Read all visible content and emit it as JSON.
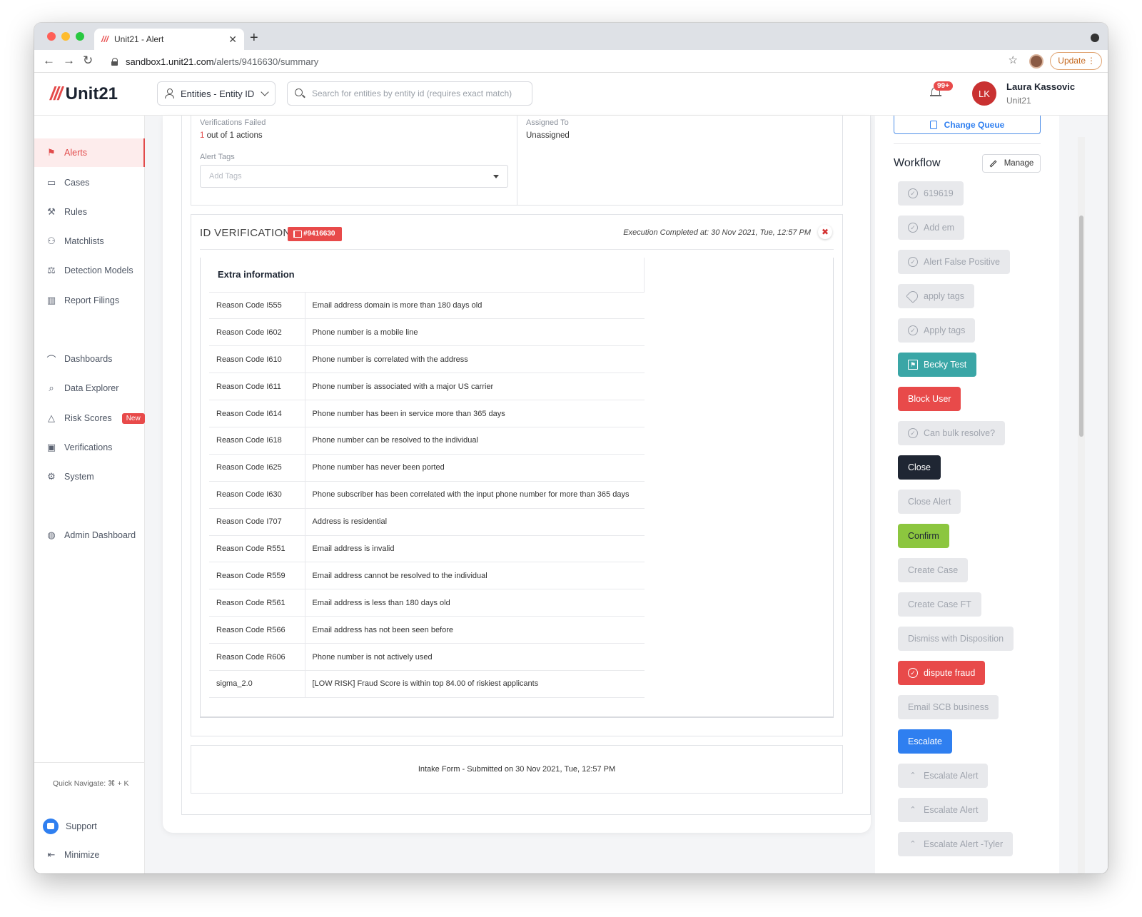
{
  "browser": {
    "tab_title": "Unit21 - Alert",
    "tab_favicon": "///",
    "tab_close": "✕",
    "new_tab": "+",
    "url_host": "sandbox1.unit21.com",
    "url_path": "/alerts/9416630/summary",
    "update_label": "Update"
  },
  "header": {
    "logo_mark": "///",
    "logo_text": "Unit21",
    "entity_select": "Entities - Entity ID",
    "search_placeholder": "Search for entities by entity id (requires exact match)",
    "notifications_badge": "99+",
    "avatar_initials": "LK",
    "user_name": "Laura Kassovic",
    "user_org": "Unit21"
  },
  "sidebar": {
    "items": [
      {
        "label": "Alerts",
        "icon": "flag-icon"
      },
      {
        "label": "Cases",
        "icon": "briefcase-icon"
      },
      {
        "label": "Rules",
        "icon": "tools-icon"
      },
      {
        "label": "Matchlists",
        "icon": "person-x-icon"
      },
      {
        "label": "Detection Models",
        "icon": "scale-icon"
      },
      {
        "label": "Report Filings",
        "icon": "building-icon"
      },
      {
        "label": "Dashboards",
        "icon": "chart-line-icon"
      },
      {
        "label": "Data Explorer",
        "icon": "data-search-icon"
      },
      {
        "label": "Risk Scores",
        "icon": "warning-icon"
      },
      {
        "label": "Verifications",
        "icon": "id-card-icon"
      },
      {
        "label": "System",
        "icon": "gear-icon"
      },
      {
        "label": "Admin Dashboard",
        "icon": "globe-icon"
      }
    ],
    "new_badge": "New",
    "quick_navigate": "Quick Navigate: ⌘ + K",
    "support": "Support",
    "minimize": "Minimize"
  },
  "summary": {
    "verifications_failed_label": "Verifications Failed",
    "verifications_failed_count": "1",
    "verifications_failed_rest": " out of 1 actions",
    "assigned_to_label": "Assigned To",
    "assigned_to_value": "Unassigned",
    "alert_tags_label": "Alert Tags",
    "alert_tags_placeholder": "Add Tags"
  },
  "id_verification": {
    "title": "ID VERIFICATION",
    "flag_label": "#9416630",
    "execution_text": "Execution Completed at: 30 Nov 2021, Tue, 12:57 PM",
    "close_glyph": "✖",
    "extra_header": "Extra information",
    "rows": [
      {
        "code": "Reason Code I555",
        "desc": "Email address domain is more than 180 days old"
      },
      {
        "code": "Reason Code I602",
        "desc": "Phone number is a mobile line"
      },
      {
        "code": "Reason Code I610",
        "desc": "Phone number is correlated with the address"
      },
      {
        "code": "Reason Code I611",
        "desc": "Phone number is associated with a major US carrier"
      },
      {
        "code": "Reason Code I614",
        "desc": "Phone number has been in service more than 365 days"
      },
      {
        "code": "Reason Code I618",
        "desc": "Phone number can be resolved to the individual"
      },
      {
        "code": "Reason Code I625",
        "desc": "Phone number has never been ported"
      },
      {
        "code": "Reason Code I630",
        "desc": "Phone subscriber has been correlated with the input phone number for more than 365 days"
      },
      {
        "code": "Reason Code I707",
        "desc": "Address is residential"
      },
      {
        "code": "Reason Code R551",
        "desc": "Email address is invalid"
      },
      {
        "code": "Reason Code R559",
        "desc": "Email address cannot be resolved to the individual"
      },
      {
        "code": "Reason Code R561",
        "desc": "Email address is less than 180 days old"
      },
      {
        "code": "Reason Code R566",
        "desc": "Email address has not been seen before"
      },
      {
        "code": "Reason Code R606",
        "desc": "Phone number is not actively used"
      },
      {
        "code": "sigma_2.0",
        "desc": "[LOW RISK] Fraud Score is within top 84.00 of riskiest applicants"
      }
    ]
  },
  "intake": {
    "text": "Intake Form - Submitted on 30 Nov 2021, Tue, 12:57 PM"
  },
  "workflow": {
    "change_queue": "Change Queue",
    "title": "Workflow",
    "manage": "Manage",
    "buttons": [
      {
        "label": "619619",
        "style": "grey",
        "icon": "check-circle-icon"
      },
      {
        "label": "Add em",
        "style": "grey",
        "icon": "check-circle-icon"
      },
      {
        "label": "Alert False Positive",
        "style": "grey",
        "icon": "check-circle-icon"
      },
      {
        "label": "apply tags",
        "style": "grey",
        "icon": "tag-icon"
      },
      {
        "label": "Apply tags",
        "style": "grey",
        "icon": "check-circle-icon"
      },
      {
        "label": "Becky Test",
        "style": "teal",
        "icon": "flag-icon"
      },
      {
        "label": "Block User",
        "style": "red",
        "icon": ""
      },
      {
        "label": "Can bulk resolve?",
        "style": "grey",
        "icon": "check-circle-icon"
      },
      {
        "label": "Close",
        "style": "dark",
        "icon": ""
      },
      {
        "label": "Close Alert",
        "style": "grey",
        "icon": ""
      },
      {
        "label": "Confirm",
        "style": "lime",
        "icon": ""
      },
      {
        "label": "Create Case",
        "style": "grey",
        "icon": ""
      },
      {
        "label": "Create Case FT",
        "style": "grey",
        "icon": ""
      },
      {
        "label": "Dismiss with Disposition",
        "style": "grey",
        "icon": ""
      },
      {
        "label": "dispute fraud",
        "style": "red",
        "icon": "check-circle-icon"
      },
      {
        "label": "Email SCB business",
        "style": "grey",
        "icon": ""
      },
      {
        "label": "Escalate",
        "style": "blue",
        "icon": ""
      },
      {
        "label": "Escalate Alert",
        "style": "grey",
        "icon": "chevrons-up-icon"
      },
      {
        "label": "Escalate Alert",
        "style": "grey",
        "icon": "chevrons-up-icon"
      },
      {
        "label": "Escalate Alert -Tyler",
        "style": "grey",
        "icon": "chevrons-up-icon"
      }
    ]
  }
}
